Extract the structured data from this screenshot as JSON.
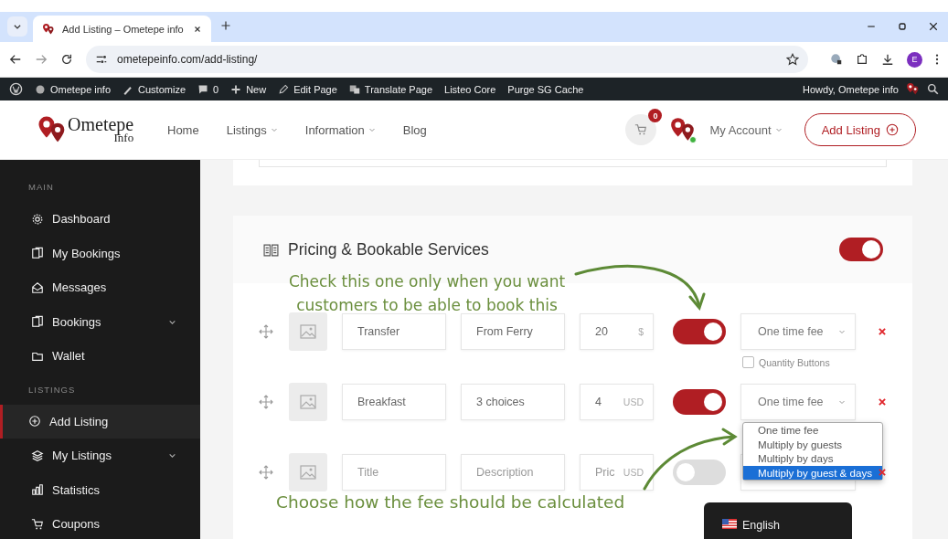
{
  "browser": {
    "tab_title": "Add Listing – Ometepe info",
    "url": "ometepeinfo.com/add-listing/",
    "profile": "E"
  },
  "admin_bar": {
    "items": [
      {
        "label": "Ometepe info"
      },
      {
        "label": "Customize"
      },
      {
        "label": "0"
      },
      {
        "label": "New"
      },
      {
        "label": "Edit Page"
      },
      {
        "label": "Translate Page"
      },
      {
        "label": "Listeo Core"
      },
      {
        "label": "Purge SG Cache"
      }
    ],
    "greeting": "Howdy, Ometepe info"
  },
  "header": {
    "logo_title": "Ometepe",
    "logo_subtitle": "Info",
    "nav": [
      {
        "label": "Home",
        "dropdown": false
      },
      {
        "label": "Listings",
        "dropdown": true
      },
      {
        "label": "Information",
        "dropdown": true
      },
      {
        "label": "Blog",
        "dropdown": false
      }
    ],
    "cart_count": "0",
    "account": "My Account",
    "add_listing": "Add Listing"
  },
  "sidebar": {
    "sections": [
      {
        "title": "MAIN",
        "items": [
          {
            "label": "Dashboard",
            "selected": false,
            "has_submenu": false
          },
          {
            "label": "My Bookings",
            "selected": false,
            "has_submenu": false
          },
          {
            "label": "Messages",
            "selected": false,
            "has_submenu": false
          },
          {
            "label": "Bookings",
            "selected": false,
            "has_submenu": true
          },
          {
            "label": "Wallet",
            "selected": false,
            "has_submenu": false
          }
        ]
      },
      {
        "title": "LISTINGS",
        "items": [
          {
            "label": "Add Listing",
            "selected": true,
            "has_submenu": false
          },
          {
            "label": "My Listings",
            "selected": false,
            "has_submenu": true
          },
          {
            "label": "Statistics",
            "selected": false,
            "has_submenu": false
          },
          {
            "label": "Coupons",
            "selected": false,
            "has_submenu": false
          }
        ]
      }
    ]
  },
  "pricing": {
    "title": "Pricing & Bookable Services",
    "on": true,
    "services": [
      {
        "title": {
          "value": "Transfer"
        },
        "description": {
          "value": "From Ferry"
        },
        "price": {
          "value": "20"
        },
        "currency": "$",
        "bookable": true,
        "fee": "One time fee",
        "quantity_buttons": {
          "label": "Quantity Buttons",
          "checked": false
        }
      },
      {
        "title": {
          "value": "Breakfast"
        },
        "description": {
          "value": "3 choices"
        },
        "price": {
          "value": "4"
        },
        "currency": "USD",
        "bookable": true,
        "fee": "One time fee"
      },
      {
        "title": {
          "placeholder": "Title"
        },
        "description": {
          "placeholder": "Description"
        },
        "price": {
          "placeholder": "Pric"
        },
        "currency": "USD",
        "bookable": false
      }
    ],
    "fee_options": [
      {
        "label": "One time fee",
        "selected": false
      },
      {
        "label": "Multiply by guests",
        "selected": false
      },
      {
        "label": "Multiply by days",
        "selected": false
      },
      {
        "label": "Multiply by guest & days",
        "selected": true
      }
    ]
  },
  "annotations": [
    "Check this one only when you want customers to be able to book this",
    "Choose how the fee should be calculated"
  ],
  "language": "English"
}
